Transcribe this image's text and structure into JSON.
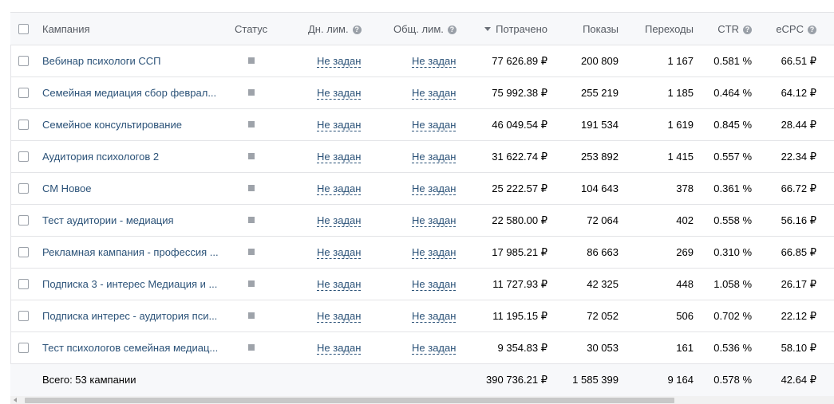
{
  "header": {
    "campaign": "Кампания",
    "status": "Статус",
    "daily_limit": "Дн. лим.",
    "total_limit": "Общ. лим.",
    "spent": "Потрачено",
    "impressions": "Показы",
    "clicks": "Переходы",
    "ctr": "CTR",
    "ecpc": "eCPC",
    "help_glyph": "?"
  },
  "rows": [
    {
      "name": "Вебинар психологи ССП",
      "daily_limit": "Не задан",
      "total_limit": "Не задан",
      "spent": "77 626.89 ₽",
      "impressions": "200 809",
      "clicks": "1 167",
      "ctr": "0.581 %",
      "ecpc": "66.51 ₽"
    },
    {
      "name": "Семейная медиация сбор феврал...",
      "daily_limit": "Не задан",
      "total_limit": "Не задан",
      "spent": "75 992.38 ₽",
      "impressions": "255 219",
      "clicks": "1 185",
      "ctr": "0.464 %",
      "ecpc": "64.12 ₽"
    },
    {
      "name": "Семейное консультирование",
      "daily_limit": "Не задан",
      "total_limit": "Не задан",
      "spent": "46 049.54 ₽",
      "impressions": "191 534",
      "clicks": "1 619",
      "ctr": "0.845 %",
      "ecpc": "28.44 ₽"
    },
    {
      "name": "Аудитория психологов 2",
      "daily_limit": "Не задан",
      "total_limit": "Не задан",
      "spent": "31 622.74 ₽",
      "impressions": "253 892",
      "clicks": "1 415",
      "ctr": "0.557 %",
      "ecpc": "22.34 ₽"
    },
    {
      "name": "СМ Новое",
      "daily_limit": "Не задан",
      "total_limit": "Не задан",
      "spent": "25 222.57 ₽",
      "impressions": "104 643",
      "clicks": "378",
      "ctr": "0.361 %",
      "ecpc": "66.72 ₽"
    },
    {
      "name": "Тест аудитории - медиация",
      "daily_limit": "Не задан",
      "total_limit": "Не задан",
      "spent": "22 580.00 ₽",
      "impressions": "72 064",
      "clicks": "402",
      "ctr": "0.558 %",
      "ecpc": "56.16 ₽"
    },
    {
      "name": "Рекламная кампания - профессия ...",
      "daily_limit": "Не задан",
      "total_limit": "Не задан",
      "spent": "17 985.21 ₽",
      "impressions": "86 663",
      "clicks": "269",
      "ctr": "0.310 %",
      "ecpc": "66.85 ₽"
    },
    {
      "name": "Подписка 3 - интерес Медиация и ...",
      "daily_limit": "Не задан",
      "total_limit": "Не задан",
      "spent": "11 727.93 ₽",
      "impressions": "42 325",
      "clicks": "448",
      "ctr": "1.058 %",
      "ecpc": "26.17 ₽"
    },
    {
      "name": "Подписка интерес - аудитория пси...",
      "daily_limit": "Не задан",
      "total_limit": "Не задан",
      "spent": "11 195.15 ₽",
      "impressions": "72 052",
      "clicks": "506",
      "ctr": "0.702 %",
      "ecpc": "22.12 ₽"
    },
    {
      "name": "Тест психологов семейная медиац...",
      "daily_limit": "Не задан",
      "total_limit": "Не задан",
      "spent": "9 354.83 ₽",
      "impressions": "30 053",
      "clicks": "161",
      "ctr": "0.536 %",
      "ecpc": "58.10 ₽"
    }
  ],
  "total": {
    "label": "Всего: 53 кампании",
    "spent": "390 736.21 ₽",
    "impressions": "1 585 399",
    "clicks": "9 164",
    "ctr": "0.578 %",
    "ecpc": "42.64 ₽"
  },
  "icons": {
    "status": "status-square-icon",
    "help": "help-circle-icon",
    "sort": "sort-desc-icon"
  },
  "colors": {
    "link": "#2b5278",
    "header_bg": "#f7f8fa",
    "border": "#e3e4e7",
    "status_grey": "#9ea3aa"
  }
}
